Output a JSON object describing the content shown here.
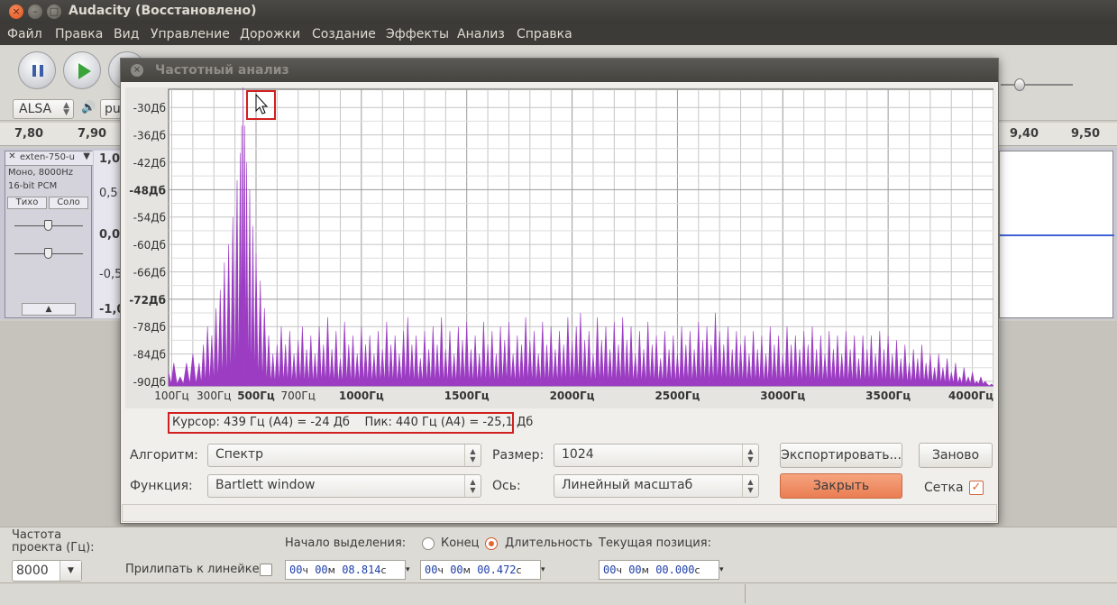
{
  "window": {
    "title": "Audacity (Восстановлено)"
  },
  "menu": [
    "Файл",
    "Правка",
    "Вид",
    "Управление",
    "Дорожки",
    "Создание",
    "Эффекты",
    "Анализ",
    "Справка"
  ],
  "toolbar": {
    "audio_host": "ALSA",
    "device_partial": "pu"
  },
  "ruler": {
    "labels_left": [
      "7,80",
      "7,90"
    ],
    "labels_right": [
      "9,40",
      "9,50"
    ]
  },
  "track": {
    "name": "exten-750-u",
    "info_line1": "Моно, 8000Hz",
    "info_line2": "16-bit PCM",
    "mute_label": "Тихо",
    "solo_label": "Соло",
    "scale": [
      "1,0",
      "0,5",
      "0,0",
      "-0,5",
      "-1,0"
    ]
  },
  "dialog": {
    "title": "Частотный анализ",
    "cursor_text": "Курсор: 439 Гц (A4) = -24 Дб",
    "peak_text": "Пик: 440 Гц (A4) = -25,1 Дб",
    "algorithm_label": "Алгоритм:",
    "algorithm_value": "Спектр",
    "function_label": "Функция:",
    "function_value": "Bartlett window",
    "size_label": "Размер:",
    "size_value": "1024",
    "axis_label": "Ось:",
    "axis_value": "Линейный масштаб",
    "export_button": "Экспортировать...",
    "replot_button": "Заново",
    "close_button": "Закрыть",
    "grid_label": "Сетка",
    "grid_checked": true
  },
  "chart_data": {
    "type": "area",
    "x_unit": "Гц",
    "y_unit": "Дб",
    "xlim": [
      85,
      4000
    ],
    "ylim": [
      -91,
      -26
    ],
    "y_ticks": [
      {
        "value": -30,
        "label": "-30Дб",
        "bold": false
      },
      {
        "value": -36,
        "label": "-36Дб",
        "bold": false
      },
      {
        "value": -42,
        "label": "-42Дб",
        "bold": false
      },
      {
        "value": -48,
        "label": "-48Дб",
        "bold": true
      },
      {
        "value": -54,
        "label": "-54Дб",
        "bold": false
      },
      {
        "value": -60,
        "label": "-60Дб",
        "bold": false
      },
      {
        "value": -66,
        "label": "-66Дб",
        "bold": false
      },
      {
        "value": -72,
        "label": "-72Дб",
        "bold": true
      },
      {
        "value": -78,
        "label": "-78Дб",
        "bold": false
      },
      {
        "value": -84,
        "label": "-84Дб",
        "bold": false
      },
      {
        "value": -90,
        "label": "-90Дб",
        "bold": false
      }
    ],
    "x_ticks": [
      {
        "value": 100,
        "label": "100Гц",
        "bold": false
      },
      {
        "value": 300,
        "label": "300Гц",
        "bold": false
      },
      {
        "value": 500,
        "label": "500Гц",
        "bold": true
      },
      {
        "value": 700,
        "label": "700Гц",
        "bold": false
      },
      {
        "value": 1000,
        "label": "1000Гц",
        "bold": true
      },
      {
        "value": 1500,
        "label": "1500Гц",
        "bold": true
      },
      {
        "value": 2000,
        "label": "2000Гц",
        "bold": true
      },
      {
        "value": 2500,
        "label": "2500Гц",
        "bold": true
      },
      {
        "value": 3000,
        "label": "3000Гц",
        "bold": true
      },
      {
        "value": 3500,
        "label": "3500Гц",
        "bold": true
      },
      {
        "value": 4000,
        "label": "4000Гц",
        "bold": true
      }
    ],
    "grid": true,
    "series": [
      {
        "color": "#9b3cc2",
        "points": [
          [
            85,
            -88
          ],
          [
            110,
            -86
          ],
          [
            140,
            -89
          ],
          [
            170,
            -86
          ],
          [
            200,
            -84
          ],
          [
            230,
            -86
          ],
          [
            250,
            -82
          ],
          [
            270,
            -78
          ],
          [
            290,
            -80
          ],
          [
            310,
            -74
          ],
          [
            330,
            -70
          ],
          [
            350,
            -64
          ],
          [
            370,
            -60
          ],
          [
            390,
            -54
          ],
          [
            410,
            -46
          ],
          [
            425,
            -40
          ],
          [
            432,
            -34
          ],
          [
            439,
            -24
          ],
          [
            446,
            -34
          ],
          [
            455,
            -42
          ],
          [
            470,
            -48
          ],
          [
            485,
            -56
          ],
          [
            500,
            -62
          ],
          [
            520,
            -68
          ],
          [
            540,
            -74
          ],
          [
            560,
            -80
          ],
          [
            580,
            -84
          ],
          [
            600,
            -82
          ],
          [
            620,
            -78
          ],
          [
            640,
            -82
          ],
          [
            660,
            -79
          ],
          [
            680,
            -84
          ],
          [
            700,
            -81
          ],
          [
            720,
            -78
          ],
          [
            740,
            -83
          ],
          [
            760,
            -80
          ],
          [
            780,
            -84
          ],
          [
            800,
            -78
          ],
          [
            820,
            -82
          ],
          [
            840,
            -76
          ],
          [
            860,
            -83
          ],
          [
            880,
            -79
          ],
          [
            900,
            -85
          ],
          [
            920,
            -77
          ],
          [
            940,
            -82
          ],
          [
            960,
            -80
          ],
          [
            980,
            -84
          ],
          [
            1000,
            -78
          ],
          [
            1020,
            -82
          ],
          [
            1040,
            -80
          ],
          [
            1060,
            -84
          ],
          [
            1080,
            -79
          ],
          [
            1100,
            -83
          ],
          [
            1120,
            -77
          ],
          [
            1140,
            -82
          ],
          [
            1160,
            -80
          ],
          [
            1180,
            -84
          ],
          [
            1200,
            -79
          ],
          [
            1220,
            -76
          ],
          [
            1240,
            -82
          ],
          [
            1260,
            -80
          ],
          [
            1280,
            -85
          ],
          [
            1300,
            -79
          ],
          [
            1320,
            -83
          ],
          [
            1340,
            -78
          ],
          [
            1360,
            -82
          ],
          [
            1380,
            -76
          ],
          [
            1400,
            -83
          ],
          [
            1420,
            -79
          ],
          [
            1440,
            -84
          ],
          [
            1460,
            -78
          ],
          [
            1480,
            -81
          ],
          [
            1500,
            -77
          ],
          [
            1520,
            -83
          ],
          [
            1540,
            -80
          ],
          [
            1560,
            -84
          ],
          [
            1580,
            -77
          ],
          [
            1600,
            -82
          ],
          [
            1620,
            -79
          ],
          [
            1640,
            -84
          ],
          [
            1660,
            -78
          ],
          [
            1680,
            -81
          ],
          [
            1700,
            -77
          ],
          [
            1720,
            -84
          ],
          [
            1740,
            -80
          ],
          [
            1760,
            -82
          ],
          [
            1780,
            -76
          ],
          [
            1800,
            -81
          ],
          [
            1820,
            -79
          ],
          [
            1840,
            -84
          ],
          [
            1860,
            -77
          ],
          [
            1880,
            -82
          ],
          [
            1900,
            -78
          ],
          [
            1920,
            -83
          ],
          [
            1940,
            -79
          ],
          [
            1960,
            -82
          ],
          [
            1980,
            -76
          ],
          [
            2000,
            -81
          ],
          [
            2020,
            -78
          ],
          [
            2040,
            -75
          ],
          [
            2060,
            -81
          ],
          [
            2080,
            -79
          ],
          [
            2100,
            -84
          ],
          [
            2120,
            -76
          ],
          [
            2140,
            -81
          ],
          [
            2160,
            -78
          ],
          [
            2180,
            -83
          ],
          [
            2200,
            -77
          ],
          [
            2220,
            -82
          ],
          [
            2240,
            -76
          ],
          [
            2260,
            -81
          ],
          [
            2280,
            -78
          ],
          [
            2300,
            -84
          ],
          [
            2320,
            -79
          ],
          [
            2340,
            -83
          ],
          [
            2360,
            -77
          ],
          [
            2380,
            -82
          ],
          [
            2400,
            -80
          ],
          [
            2420,
            -85
          ],
          [
            2440,
            -79
          ],
          [
            2460,
            -83
          ],
          [
            2480,
            -80
          ],
          [
            2500,
            -84
          ],
          [
            2520,
            -78
          ],
          [
            2540,
            -82
          ],
          [
            2560,
            -79
          ],
          [
            2580,
            -83
          ],
          [
            2600,
            -77
          ],
          [
            2620,
            -81
          ],
          [
            2640,
            -78
          ],
          [
            2660,
            -82
          ],
          [
            2680,
            -75
          ],
          [
            2700,
            -79
          ],
          [
            2720,
            -82
          ],
          [
            2740,
            -78
          ],
          [
            2760,
            -83
          ],
          [
            2780,
            -79
          ],
          [
            2800,
            -82
          ],
          [
            2820,
            -80
          ],
          [
            2840,
            -84
          ],
          [
            2860,
            -79
          ],
          [
            2880,
            -83
          ],
          [
            2900,
            -80
          ],
          [
            2920,
            -84
          ],
          [
            2940,
            -78
          ],
          [
            2960,
            -82
          ],
          [
            2980,
            -80
          ],
          [
            3000,
            -84
          ],
          [
            3020,
            -78
          ],
          [
            3040,
            -82
          ],
          [
            3060,
            -80
          ],
          [
            3080,
            -83
          ],
          [
            3100,
            -79
          ],
          [
            3120,
            -82
          ],
          [
            3140,
            -78
          ],
          [
            3160,
            -83
          ],
          [
            3180,
            -80
          ],
          [
            3200,
            -84
          ],
          [
            3220,
            -79
          ],
          [
            3240,
            -83
          ],
          [
            3260,
            -80
          ],
          [
            3280,
            -84
          ],
          [
            3300,
            -79
          ],
          [
            3320,
            -83
          ],
          [
            3340,
            -80
          ],
          [
            3360,
            -85
          ],
          [
            3380,
            -80
          ],
          [
            3400,
            -83
          ],
          [
            3420,
            -80
          ],
          [
            3440,
            -84
          ],
          [
            3460,
            -79
          ],
          [
            3480,
            -83
          ],
          [
            3500,
            -80
          ],
          [
            3520,
            -84
          ],
          [
            3540,
            -81
          ],
          [
            3560,
            -85
          ],
          [
            3580,
            -82
          ],
          [
            3600,
            -86
          ],
          [
            3620,
            -83
          ],
          [
            3640,
            -85
          ],
          [
            3660,
            -82
          ],
          [
            3680,
            -86
          ],
          [
            3700,
            -84
          ],
          [
            3720,
            -87
          ],
          [
            3740,
            -84
          ],
          [
            3760,
            -87
          ],
          [
            3780,
            -85
          ],
          [
            3800,
            -88
          ],
          [
            3820,
            -86
          ],
          [
            3840,
            -89
          ],
          [
            3860,
            -87
          ],
          [
            3880,
            -89
          ],
          [
            3900,
            -88
          ],
          [
            3920,
            -90
          ],
          [
            3940,
            -89
          ],
          [
            3960,
            -90
          ],
          [
            3980,
            -91
          ],
          [
            4000,
            -91
          ]
        ]
      }
    ]
  },
  "bottom": {
    "rate_label": "Частота проекта (Гц):",
    "rate_value": "8000",
    "snap_label": "Прилипать к линейке",
    "selection_start_label": "Начало выделения:",
    "end_label": "Конец",
    "length_label": "Длительность",
    "position_label": "Текущая позиция:",
    "start_h": "00",
    "start_m": "00",
    "start_s": "08.814",
    "len_h": "00",
    "len_m": "00",
    "len_s": "00.472",
    "pos_h": "00",
    "pos_m": "00",
    "pos_s": "00.000",
    "unit_h": "ч",
    "unit_m": "м",
    "unit_s": "с"
  }
}
